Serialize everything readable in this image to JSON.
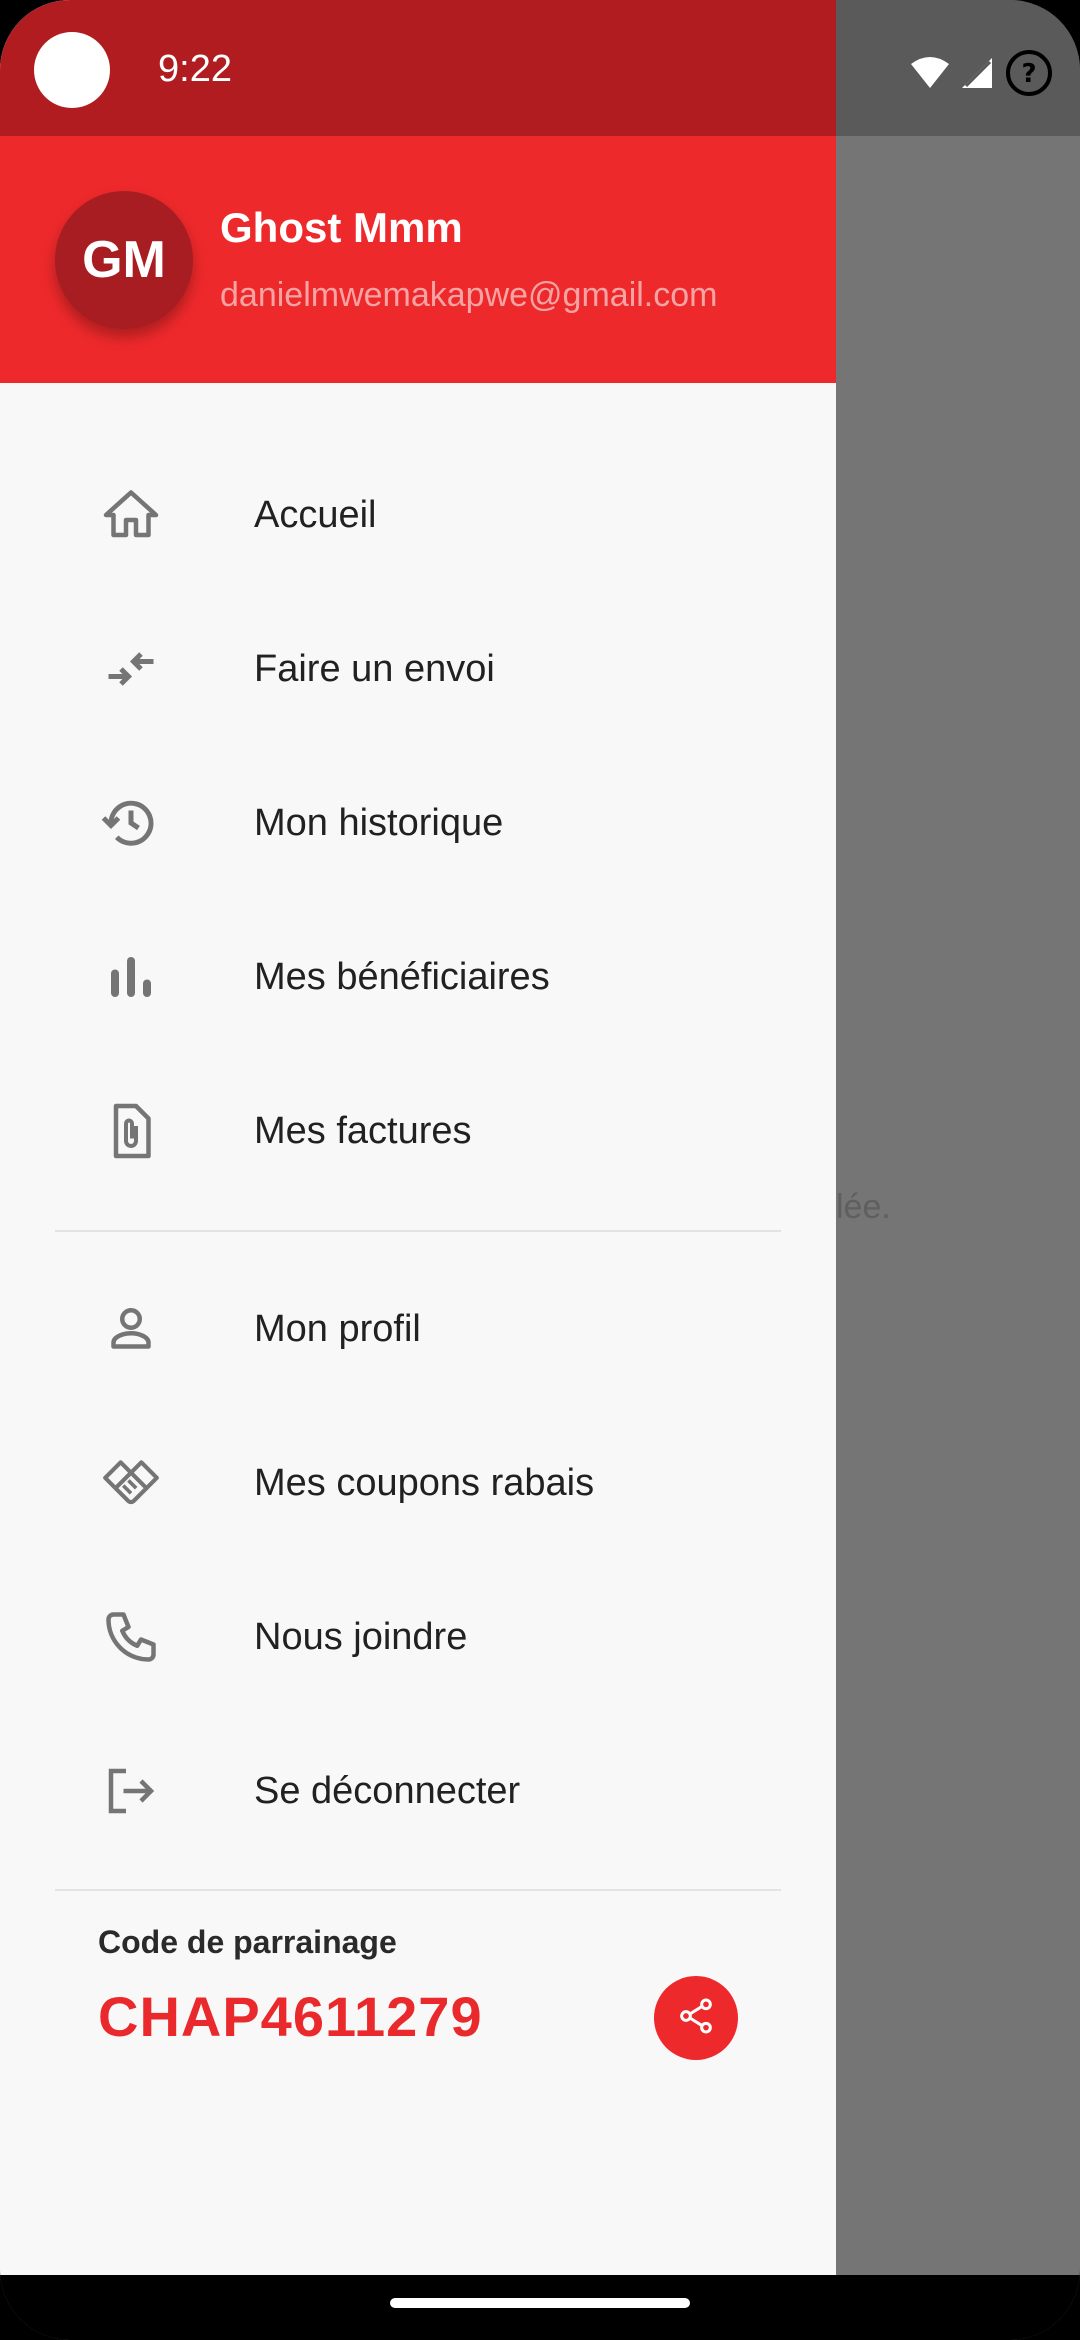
{
  "status_bar": {
    "time": "9:22",
    "icons": [
      "wifi-icon",
      "cell-signal-icon",
      "help-circle-icon"
    ]
  },
  "background": {
    "partial_text": "lée."
  },
  "user": {
    "initials": "GM",
    "name": "Ghost Mmm",
    "email": "danielmwemakapwe@gmail.com"
  },
  "menu": {
    "items": [
      {
        "label": "Accueil",
        "icon": "home-icon"
      },
      {
        "label": "Faire un envoi",
        "icon": "transfer-arrows-icon"
      },
      {
        "label": "Mon historique",
        "icon": "history-icon"
      },
      {
        "label": "Mes bénéficiaires",
        "icon": "bar-chart-icon"
      },
      {
        "label": "Mes factures",
        "icon": "attachment-file-icon"
      },
      {
        "label": "Mon profil",
        "icon": "person-icon"
      },
      {
        "label": "Mes coupons rabais",
        "icon": "handshake-icon"
      },
      {
        "label": "Nous joindre",
        "icon": "phone-icon"
      },
      {
        "label": "Se déconnecter",
        "icon": "logout-icon"
      }
    ]
  },
  "referral": {
    "title": "Code de parrainage",
    "code": "CHAP4611279",
    "share_icon": "share-icon"
  },
  "colors": {
    "brand_red": "#ee292b",
    "status_bar_red": "#b01c20",
    "avatar_bg": "#a71d22",
    "scrim": "#757575"
  }
}
